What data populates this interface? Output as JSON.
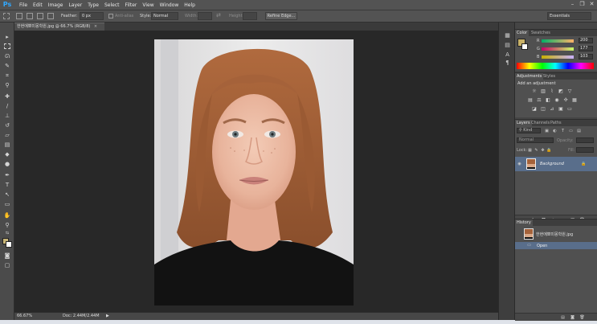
{
  "app": {
    "logo": "Ps"
  },
  "menu": [
    "File",
    "Edit",
    "Image",
    "Layer",
    "Type",
    "Select",
    "Filter",
    "View",
    "Window",
    "Help"
  ],
  "window_controls": {
    "minimize": "–",
    "restore": "❐",
    "close": "✕"
  },
  "options": {
    "feather_label": "Feather:",
    "feather_value": "0 px",
    "antialias_label": "Anti-alias",
    "style_label": "Style:",
    "style_value": "Normal",
    "width_label": "Width:",
    "height_label": "Height:",
    "refine_edge": "Refine Edge...",
    "workspace": "Essentials"
  },
  "document": {
    "tab_title": "한현에뽀미몽학원.jpg @ 66.7% (RGB/8)"
  },
  "status": {
    "zoom": "66.67%",
    "doc": "Doc: 2.44M/2.44M"
  },
  "color_panel": {
    "tabs": [
      "Color",
      "Swatches"
    ],
    "r": {
      "label": "R",
      "value": "200"
    },
    "g": {
      "label": "G",
      "value": "177"
    },
    "b": {
      "label": "B",
      "value": "103"
    },
    "fg_hex": "#c8b167"
  },
  "adjustments_panel": {
    "tabs": [
      "Adjustments",
      "Styles"
    ],
    "title": "Add an adjustment"
  },
  "layers_panel": {
    "tabs": [
      "Layers",
      "Channels",
      "Paths"
    ],
    "kind_filter": "Kind",
    "blend_mode": "Normal",
    "opacity_label": "Opacity:",
    "lock_label": "Lock:",
    "fill_label": "Fill:",
    "layer_name": "Background"
  },
  "history_panel": {
    "tabs": [
      "History"
    ],
    "snapshot": "한현에뽀미몽학원.jpg",
    "step": "Open"
  },
  "colors": {
    "chrome": "#535353",
    "panel": "#505050",
    "selected_row": "#596e8b",
    "accent": "#31a8ff",
    "foreground_swatch": "#c8b576",
    "background_swatch": "#ffffff"
  }
}
